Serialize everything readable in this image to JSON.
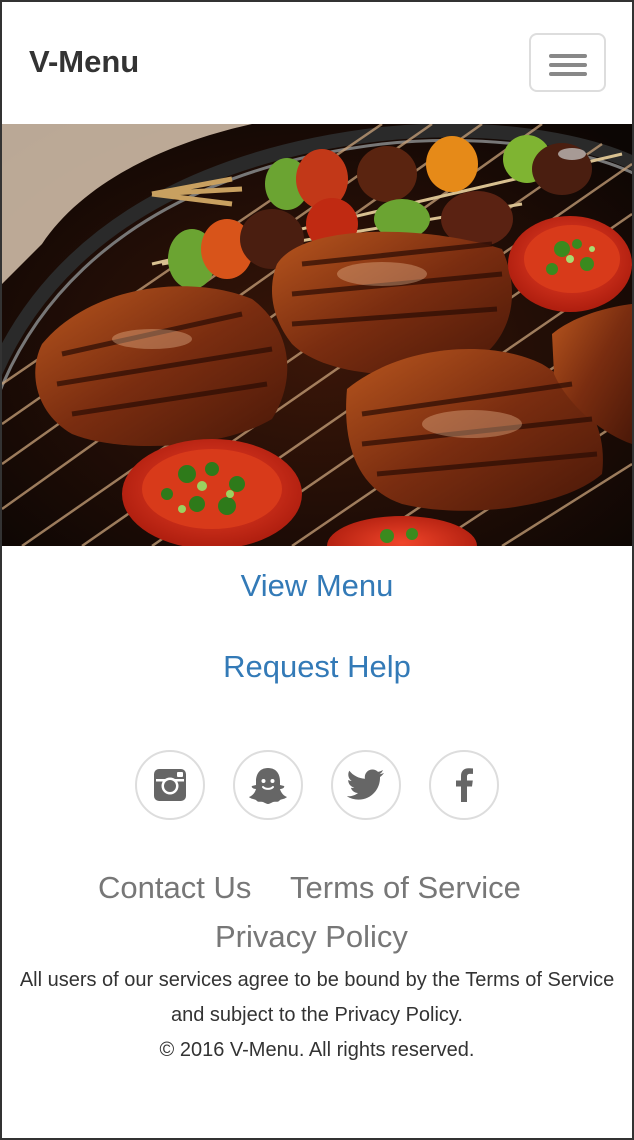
{
  "header": {
    "brand": "V-Menu",
    "menu_icon": "hamburger-menu-icon"
  },
  "hero": {
    "image": "grilled-steaks-and-vegetable-skewers-photo"
  },
  "main": {
    "view_menu": "View Menu",
    "request_help": "Request Help"
  },
  "social": [
    {
      "icon": "instagram-icon"
    },
    {
      "icon": "snapchat-icon"
    },
    {
      "icon": "twitter-icon"
    },
    {
      "icon": "facebook-icon"
    }
  ],
  "footer": {
    "contact": "Contact Us",
    "terms": "Terms of Service",
    "privacy": "Privacy Policy",
    "agreement_line1": "All users of our services agree to be bound by the Terms of Service",
    "agreement_line2": "and subject to the Privacy Policy.",
    "copyright": "© 2016 V-Menu. All rights reserved."
  },
  "colors": {
    "link": "#337ab7",
    "footer_link": "#777777",
    "text": "#333333",
    "border": "#dddddd"
  }
}
